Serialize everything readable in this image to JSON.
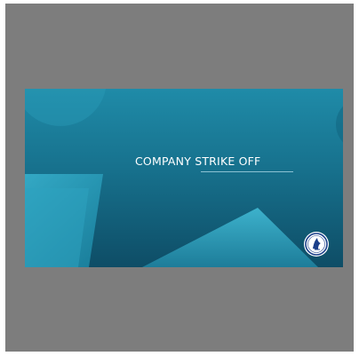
{
  "slide": {
    "title": "COMPANY STRIKE OFF"
  },
  "colors": {
    "viewer_background": "#7d7d7d",
    "slide_top": "#1f8ba8",
    "slide_bottom": "#0e4d66",
    "accent_light": "#35b0cc",
    "title_text": "#ffffff"
  },
  "icons": {
    "logo": "seal-logo-icon"
  }
}
